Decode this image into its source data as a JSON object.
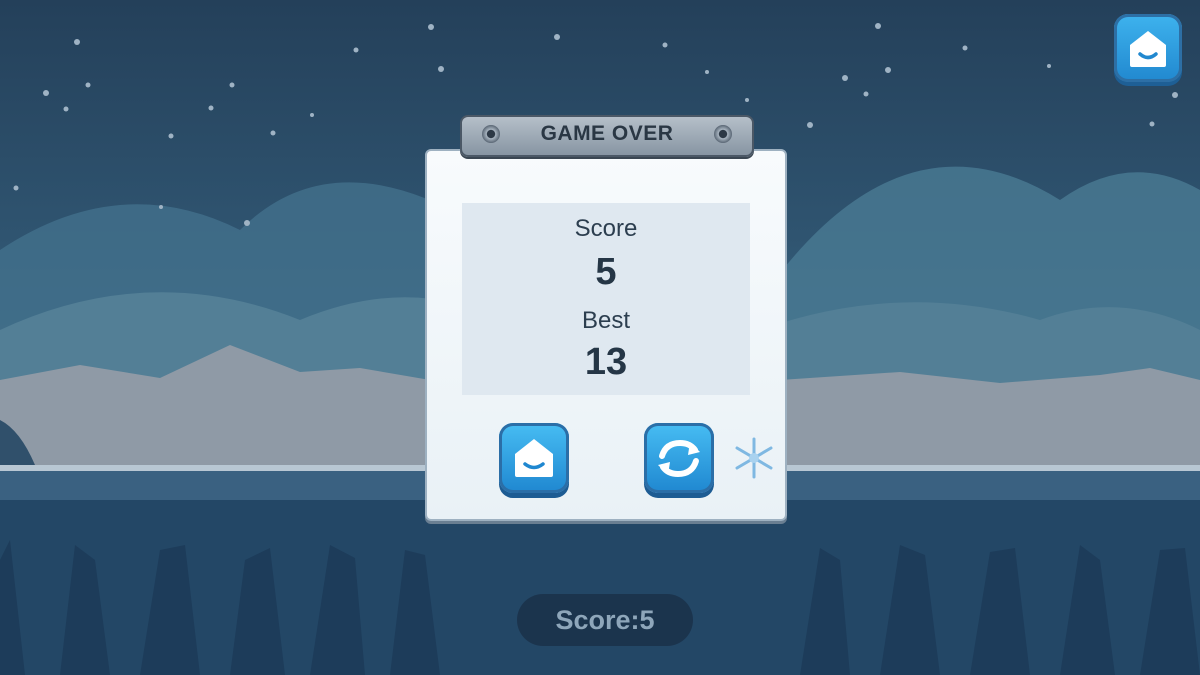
{
  "colors": {
    "sky_top": "#24405a",
    "button_blue": "#2b9ae0",
    "panel_bg": "#f4f8fb",
    "text_dark": "#253646"
  },
  "hud": {
    "home_icon": "home-icon"
  },
  "panel": {
    "title": "GAME OVER",
    "score_label": "Score",
    "score_value": "5",
    "best_label": "Best",
    "best_value": "13",
    "buttons": [
      {
        "icon": "home-icon"
      },
      {
        "icon": "restart-icon"
      }
    ],
    "decoration_icon": "snowflake-icon"
  },
  "footer": {
    "score_text": "Score:5"
  }
}
